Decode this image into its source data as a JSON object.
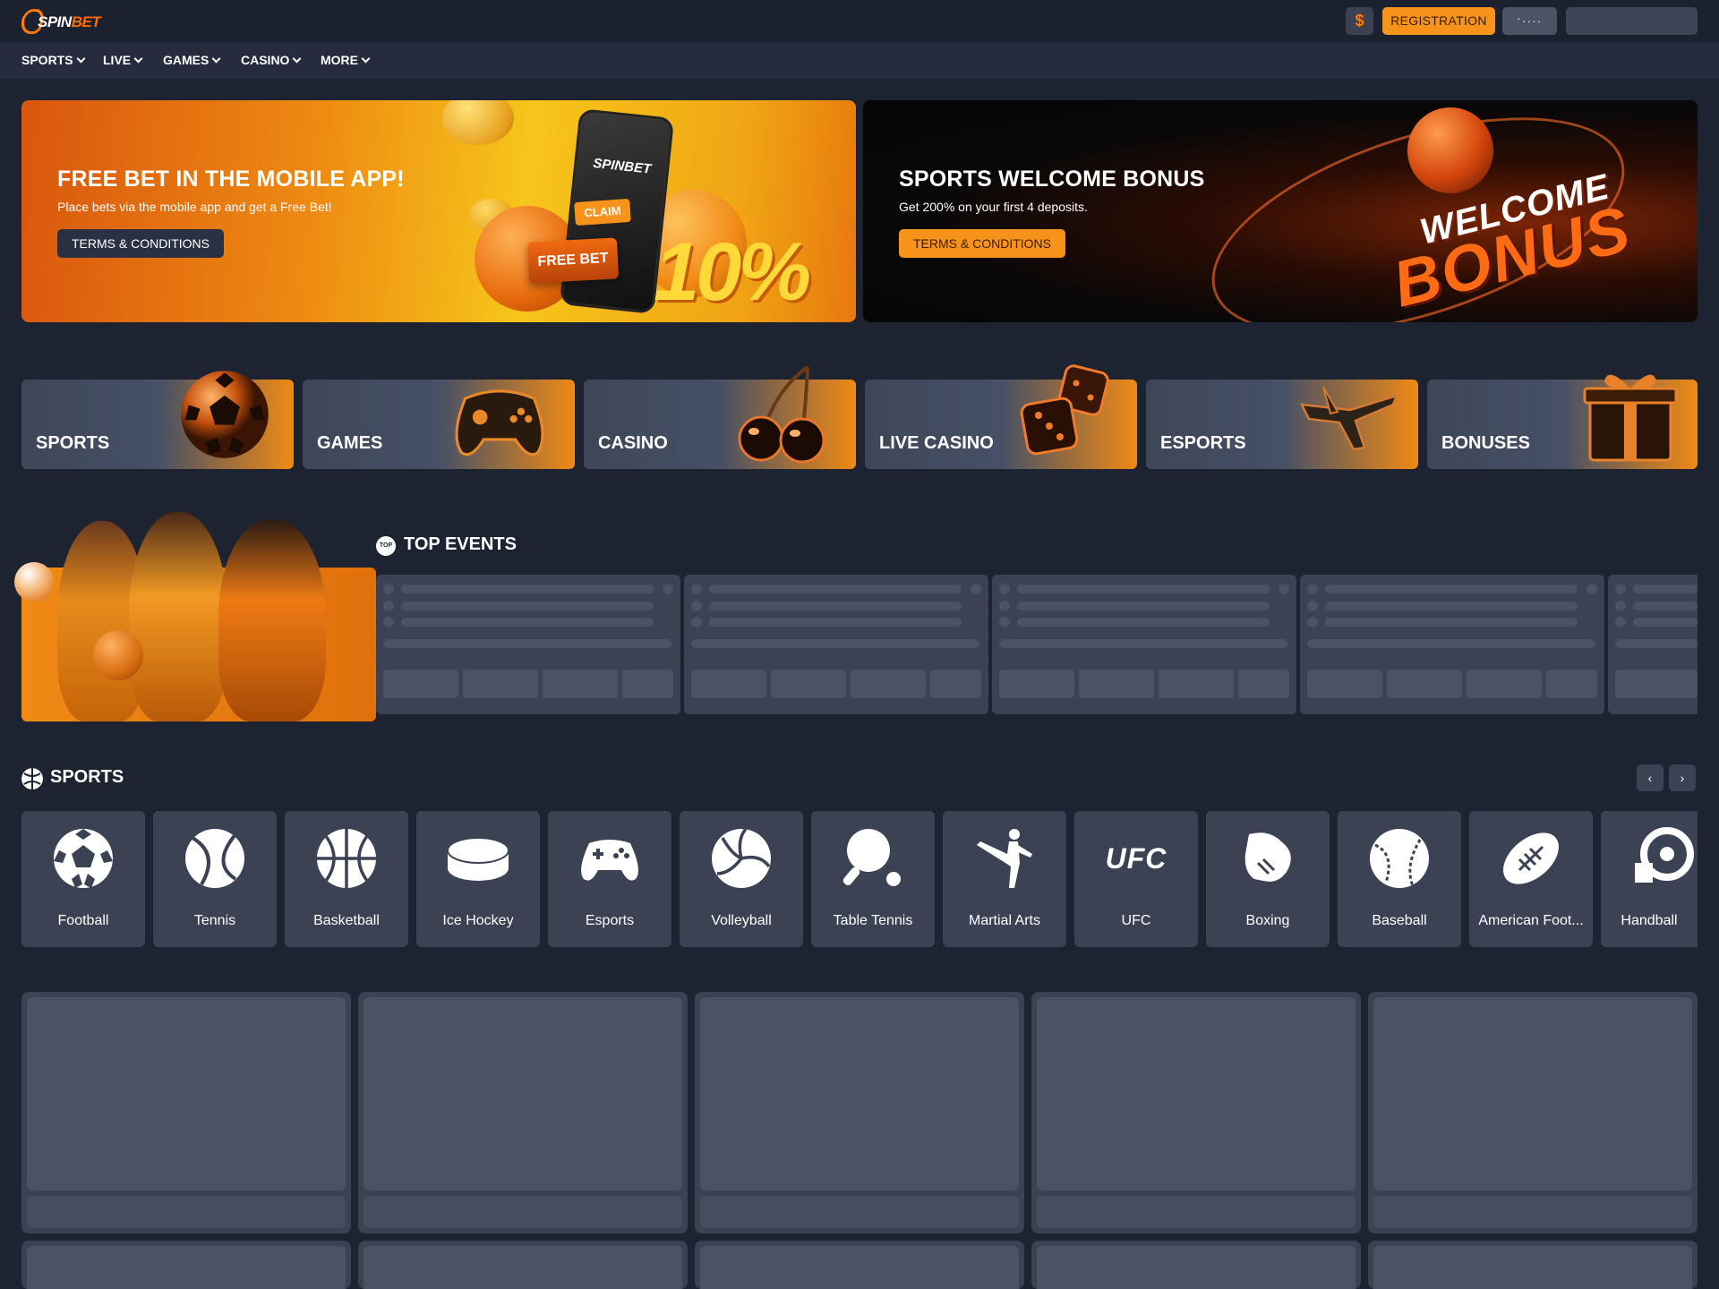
{
  "header": {
    "logo_text_a": "SPIN",
    "logo_text_b": "BET",
    "currency_symbol": "$",
    "registration_label": "REGISTRATION",
    "login_label": "·...."
  },
  "nav": {
    "items": [
      {
        "label": "SPORTS"
      },
      {
        "label": "LIVE"
      },
      {
        "label": "GAMES"
      },
      {
        "label": "CASINO"
      },
      {
        "label": "MORE"
      }
    ]
  },
  "banners": [
    {
      "title": "FREE BET IN THE MOBILE APP!",
      "subtitle": "Place bets via the mobile app and get a Free Bet!",
      "button": "TERMS & CONDITIONS",
      "art_phone": "SPINBET",
      "art_claim": "CLAIM",
      "art_freebet": "FREE BET",
      "art_percent": "10%"
    },
    {
      "title": "SPORTS WELCOME BONUS",
      "subtitle": "Get 200% on your first 4 deposits.",
      "button": "TERMS & CONDITIONS",
      "art_line1": "WELCOME",
      "art_line2": "BONUS"
    }
  ],
  "categories": [
    {
      "label": "SPORTS",
      "icon": "soccer-ball-icon"
    },
    {
      "label": "GAMES",
      "icon": "gamepad-icon"
    },
    {
      "label": "CASINO",
      "icon": "cherries-icon"
    },
    {
      "label": "LIVE CASINO",
      "icon": "dice-icon"
    },
    {
      "label": "ESPORTS",
      "icon": "airplane-icon"
    },
    {
      "label": "BONUSES",
      "icon": "gift-icon"
    }
  ],
  "top_events": {
    "badge": "TOP",
    "title": "TOP EVENTS"
  },
  "sports_section": {
    "title": "SPORTS",
    "prev": "‹",
    "next": "›",
    "items": [
      {
        "name": "Football",
        "icon": "football-icon"
      },
      {
        "name": "Tennis",
        "icon": "tennis-icon"
      },
      {
        "name": "Basketball",
        "icon": "basketball-icon"
      },
      {
        "name": "Ice Hockey",
        "icon": "ice-hockey-icon"
      },
      {
        "name": "Esports",
        "icon": "esports-icon"
      },
      {
        "name": "Volleyball",
        "icon": "volleyball-icon"
      },
      {
        "name": "Table Tennis",
        "icon": "table-tennis-icon"
      },
      {
        "name": "Martial Arts",
        "icon": "martial-arts-icon"
      },
      {
        "name": "UFC",
        "icon": "ufc-icon",
        "glyph": "UFC"
      },
      {
        "name": "Boxing",
        "icon": "boxing-icon"
      },
      {
        "name": "Baseball",
        "icon": "baseball-icon"
      },
      {
        "name": "American Foot...",
        "icon": "american-football-icon"
      },
      {
        "name": "Handball",
        "icon": "handball-icon"
      }
    ]
  },
  "colors": {
    "background": "#1e2332",
    "accent": "#f7931a",
    "panel": "#3b4254"
  }
}
